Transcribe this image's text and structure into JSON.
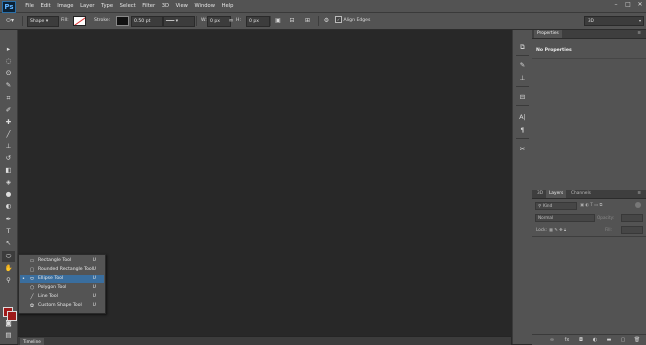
{
  "app": {
    "logo": "Ps"
  },
  "menu": [
    "File",
    "Edit",
    "Image",
    "Layer",
    "Type",
    "Select",
    "Filter",
    "3D",
    "View",
    "Window",
    "Help"
  ],
  "window_controls": [
    "–",
    "□",
    "✕"
  ],
  "options_bar": {
    "mode": "Shape",
    "fill_label": "Fill:",
    "stroke_label": "Stroke:",
    "stroke_width": "0.50 pt",
    "w_label": "W:",
    "w_value": "0 px",
    "h_label": "H:",
    "h_value": "0 px",
    "align_edges_label": "Align Edges",
    "align_edges_checked": true,
    "workspace": "3D"
  },
  "toolbar": {
    "tools": [
      {
        "name": "move-tool-icon",
        "glyph": "▸"
      },
      {
        "name": "marquee-tool-icon",
        "glyph": "◌"
      },
      {
        "name": "lasso-tool-icon",
        "glyph": "ʘ"
      },
      {
        "name": "quick-select-tool-icon",
        "glyph": "✎"
      },
      {
        "name": "crop-tool-icon",
        "glyph": "⌗"
      },
      {
        "name": "eyedropper-tool-icon",
        "glyph": "✐"
      },
      {
        "name": "healing-brush-tool-icon",
        "glyph": "✚"
      },
      {
        "name": "brush-tool-icon",
        "glyph": "╱"
      },
      {
        "name": "clone-stamp-tool-icon",
        "glyph": "⊥"
      },
      {
        "name": "history-brush-tool-icon",
        "glyph": "↺"
      },
      {
        "name": "eraser-tool-icon",
        "glyph": "◧"
      },
      {
        "name": "paint-bucket-tool-icon",
        "glyph": "◈"
      },
      {
        "name": "blur-tool-icon",
        "glyph": "●"
      },
      {
        "name": "dodge-tool-icon",
        "glyph": "◐"
      },
      {
        "name": "pen-tool-icon",
        "glyph": "✒"
      },
      {
        "name": "type-tool-icon",
        "glyph": "T"
      },
      {
        "name": "path-selection-tool-icon",
        "glyph": "↖"
      },
      {
        "name": "ellipse-tool-icon",
        "glyph": "⬭"
      },
      {
        "name": "hand-tool-icon",
        "glyph": "✋"
      },
      {
        "name": "zoom-tool-icon",
        "glyph": "⚲"
      }
    ],
    "foreground_color": "#9e1a1a",
    "background_color": "#9e1a1a"
  },
  "flyout": {
    "items": [
      {
        "icon": "rectangle-tool-icon",
        "glyph": "▭",
        "label": "Rectangle Tool",
        "key": "U",
        "selected": false
      },
      {
        "icon": "rounded-rectangle-tool-icon",
        "glyph": "▢",
        "label": "Rounded Rectangle Tool",
        "key": "U",
        "selected": false
      },
      {
        "icon": "ellipse-tool-icon",
        "glyph": "⬭",
        "label": "Ellipse Tool",
        "key": "U",
        "selected": true
      },
      {
        "icon": "polygon-tool-icon",
        "glyph": "⬡",
        "label": "Polygon Tool",
        "key": "U",
        "selected": false
      },
      {
        "icon": "line-tool-icon",
        "glyph": "╱",
        "label": "Line Tool",
        "key": "U",
        "selected": false
      },
      {
        "icon": "custom-shape-tool-icon",
        "glyph": "✿",
        "label": "Custom Shape Tool",
        "key": "U",
        "selected": false
      }
    ]
  },
  "timeline": {
    "tab_label": "Timeline"
  },
  "right_panels": {
    "properties_tab": "Properties",
    "no_properties": "No Properties",
    "tabs": [
      "3D",
      "Layers",
      "Channels"
    ],
    "active_tab": "Layers",
    "kind_label": "Kind",
    "blend_mode": "Normal",
    "opacity_label": "Opacity:",
    "lock_label": "Lock:",
    "fill_label": "Fill:"
  },
  "accent_colors": {
    "selection": "#3a6e9e",
    "ps_blue": "#5fb2ff",
    "swatch_red": "#9e1a1a"
  }
}
